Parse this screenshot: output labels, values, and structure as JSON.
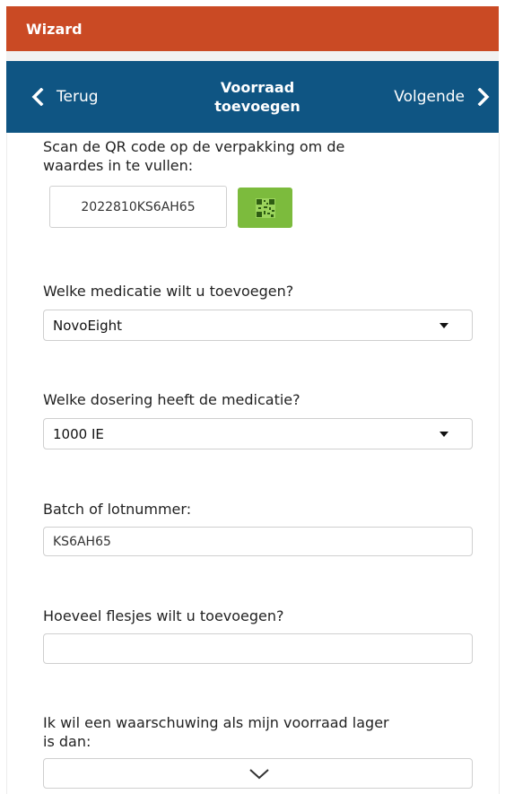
{
  "header": {
    "title": "Wizard"
  },
  "nav": {
    "back_label": "Terug",
    "title_line1": "Voorraad",
    "title_line2": "toevoegen",
    "next_label": "Volgende",
    "back_icon": "chevron-left-icon",
    "next_icon": "chevron-right-icon"
  },
  "qr": {
    "instruction_line1": "Scan de QR code op de verpakking om de",
    "instruction_line2": "waardes in te vullen:",
    "code_value": "2022810KS6AH65",
    "button_icon": "qr-code-icon",
    "button_color": "#7cbb3d"
  },
  "medication": {
    "label": "Welke medicatie wilt u toevoegen?",
    "selected": "NovoEight"
  },
  "dosage": {
    "label": "Welke dosering heeft de medicatie?",
    "selected": "1000 IE"
  },
  "batch": {
    "label": "Batch of lotnummer:",
    "value": "KS6AH65"
  },
  "quantity": {
    "label": "Hoeveel flesjes wilt u toevoegen?",
    "value": ""
  },
  "warning": {
    "label_line1": "Ik wil een waarschuwing als mijn voorraad lager",
    "label_line2": "is dan:",
    "icon": "chevron-down-icon"
  },
  "colors": {
    "header_bg": "#ca4a24",
    "nav_bg": "#0f5583",
    "accent": "#7cbb3d"
  }
}
